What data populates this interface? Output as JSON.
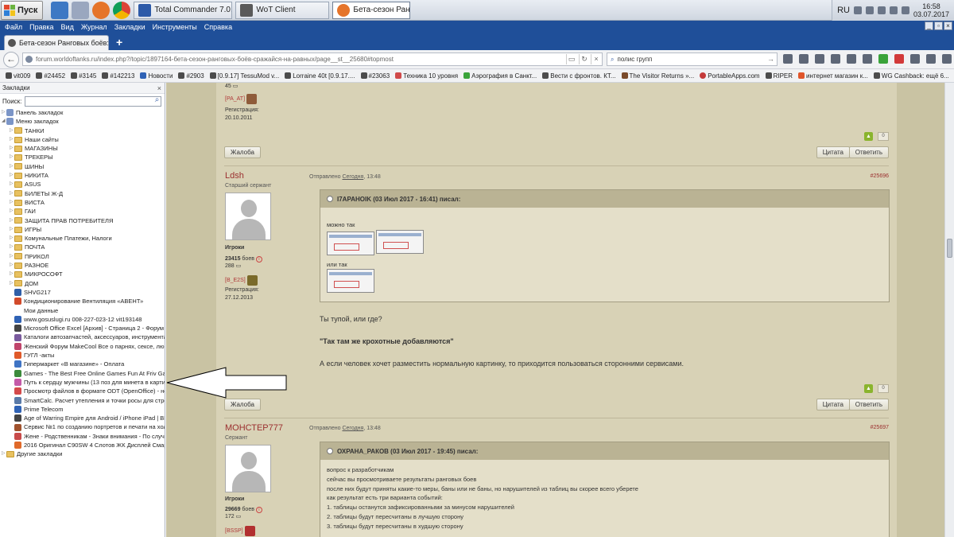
{
  "taskbar": {
    "start_label": "Пуск",
    "tasks": [
      {
        "label": "Total Commander 7.0...",
        "color": "#2d5aa8",
        "active": false
      },
      {
        "label": "WoT Client",
        "color": "#5a5a5a",
        "active": false
      },
      {
        "label": "Бета-сезон Рангово...",
        "color": "#e5742a",
        "active": true
      }
    ],
    "lang": "RU",
    "time": "16:58",
    "date": "03.07.2017"
  },
  "menubar": {
    "items": [
      "Файл",
      "Правка",
      "Вид",
      "Журнал",
      "Закладки",
      "Инструменты",
      "Справка"
    ]
  },
  "tab": {
    "title": "Бета-сезон Ранговых боёв: ср"
  },
  "nav": {
    "url": "forum.worldoftanks.ru/index.php?/topic/1897164-бета-сезон-ранговых-боёв-сражайся-на-равных/page__st__25680#topmost",
    "search": "полис групп"
  },
  "bookmarks_bar": [
    "vit009",
    "#24452",
    "#3145",
    "#142213",
    "Новости",
    "#2903",
    "[0.9.17] TessuMod v...",
    "Lorraine 40t [0.9.17....",
    "#23063",
    "Техника 10 уровня",
    "Аэрография в Санкт...",
    "Вести с фронтов. КТ...",
    "The Visitor Returns »...",
    "PortableApps.com",
    "RIPER",
    "интернет магазин к...",
    "WG Cashback: ещё 6..."
  ],
  "sidebar": {
    "title": "Закладки",
    "search_label": "Поиск:",
    "root": [
      {
        "label": "Панель закладок",
        "type": "folder-root"
      },
      {
        "label": "Меню закладок",
        "type": "folder-root-open"
      }
    ],
    "folders": [
      "ТАНКИ",
      "Наши сайты",
      "МАГАЗИНЫ",
      "ТРЕКЕРЫ",
      "ШИНЫ",
      "НИКИТА",
      "ASUS",
      "БИЛЕТЫ Ж-Д",
      "ВИСТА",
      "ГАИ",
      "ЗАЩИТА ПРАВ ПОТРЕБИТЕЛЯ",
      "ИГРЫ",
      "Комунальные Платежи, Налоги",
      "ПОЧТА",
      "ПРИКОЛ",
      "РАЗНОЕ",
      "МИКРОСОФТ",
      "ДОМ"
    ],
    "links": [
      {
        "label": "SHVG217",
        "color": "#2f5fa8"
      },
      {
        "label": "Кондиционирование  Вентиляция «АВЕНТ»",
        "color": "#d24a2a"
      },
      {
        "label": "Мои данные",
        "color": "#ffffff"
      },
      {
        "label": "www.gosuslugi.ru 008-227-023-12 vit193148",
        "color": "#2f62b5"
      },
      {
        "label": "Microsoft Office Excel [Архив] - Страница 2 - Форум пр...",
        "color": "#444444"
      },
      {
        "label": "Каталоги автозапчастей, аксессуаров, инструмента ...",
        "color": "#7a5b9e"
      },
      {
        "label": "Женский Форум MakeCool  Все о парнях, сексе, любв...",
        "color": "#c0446b"
      },
      {
        "label": "ГУГЛ -акты",
        "color": "#e05a2a"
      },
      {
        "label": "Гипермаркет «В магазине» - Оплата",
        "color": "#3f74c4"
      },
      {
        "label": "Games - The Best Free Online Games Fun At Friv Games!",
        "color": "#3c8a3c"
      },
      {
        "label": "Путь к сердцу мужчины (13 поз для минета в картин...",
        "color": "#c45aa8"
      },
      {
        "label": "Просмотр файлов в формате ODT (OpenOffice) - не зн...",
        "color": "#d44a4a"
      },
      {
        "label": "SmartCalc. Расчет утепления и точки росы для строя...",
        "color": "#5a7aa8"
      },
      {
        "label": "Prime Telecom",
        "color": "#2f62b5"
      },
      {
        "label": "Age of Warring Empire для Android / iPhone iPad | ВКон...",
        "color": "#444444"
      },
      {
        "label": "Сервис №1 по созданию портретов и печати на холс...",
        "color": "#a0522d"
      },
      {
        "label": "Жене - Родственникам - Знаки внимания - По случаю...",
        "color": "#c84a4a"
      },
      {
        "label": "2016 Оригинал C90SW 4 Слотов ЖК Дисплей Смарт И...",
        "color": "#e06a2a"
      }
    ],
    "other": "Другие закладки"
  },
  "forum": {
    "prev_post": {
      "count": "45",
      "clan": "[PA_AT]",
      "reg_label": "Регистрация:",
      "reg_date": "20.10.2011",
      "rep": "0",
      "complain": "Жалоба",
      "quote": "Цитата",
      "reply": "Ответить"
    },
    "post1": {
      "author": "Ldsh",
      "rank": "Старший сержант",
      "posted_prefix": "Отправлено",
      "posted_day": "Сегодня",
      "posted_time": ", 13:48",
      "number": "#25696",
      "group": "Игроки",
      "battles": "23415",
      "battles_label": "боев",
      "posts": "288",
      "clan": "[B_E2S]",
      "reg_label": "Регистрация:",
      "reg_date": "27.12.2013",
      "quote_head": "I7APAHOIK (03 Июл 2017 - 16:41) писал:",
      "quote_line1": "можно так",
      "quote_line2": "или так",
      "text1": "Ты тупой, или где?",
      "text2": "\"Так там же крохотные добавляются\"",
      "text3": "А если человек хочет разместить нормальную картинку, то приходится пользоваться сторонними сервисами.",
      "rep": "0",
      "complain": "Жалоба",
      "quote": "Цитата",
      "reply": "Ответить"
    },
    "post2": {
      "author": "МОНСТЕР777",
      "rank": "Сержант",
      "posted_prefix": "Отправлено",
      "posted_day": "Сегодня",
      "posted_time": ", 13:48",
      "number": "#25697",
      "group": "Игроки",
      "battles": "29669",
      "battles_label": "боев",
      "posts": "172",
      "clan": "[BSSP]",
      "quote_head": "ОХРАНА_РАКОВ (03 Июл 2017 - 19:45) писал:",
      "quote_lines": [
        "вопрос к разработчикам",
        "сейчас вы просмотриваете результаты ранговых боев",
        "после них будут приняты какие-то меры, баны или не баны, но нарушителей из таблиц вы скорее всего уберете",
        "как результат есть три варианта событий:",
        "1. таблицы останутся зафиксированными за минусом нарушителей",
        "2. таблицы будут пересчитаны в лучшую сторону",
        "3. таблицы будут пересчитаны в худшую сторону"
      ]
    }
  }
}
